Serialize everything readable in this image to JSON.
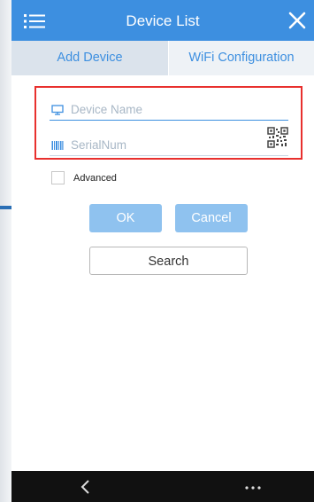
{
  "titlebar": {
    "title": "Device List",
    "menu_icon": "menu-list-icon",
    "close_icon": "close-icon",
    "bg_color": "#3d8fe0"
  },
  "tabs": [
    {
      "label": "Add Device",
      "active": true
    },
    {
      "label": "WiFi Configuration",
      "active": false
    }
  ],
  "form": {
    "device_name": {
      "placeholder": "Device Name",
      "value": "",
      "icon": "monitor-icon"
    },
    "serial_num": {
      "placeholder": "SerialNum",
      "value": "",
      "icon": "barcode-icon",
      "scan_icon": "qr-code-icon"
    },
    "highlight_color": "#e8302e"
  },
  "advanced": {
    "label": "Advanced",
    "checked": false
  },
  "buttons": {
    "ok": "OK",
    "cancel": "Cancel",
    "search": "Search"
  },
  "navbar": {
    "back_icon": "back-chevron-icon",
    "more_icon": "more-dots-icon"
  }
}
